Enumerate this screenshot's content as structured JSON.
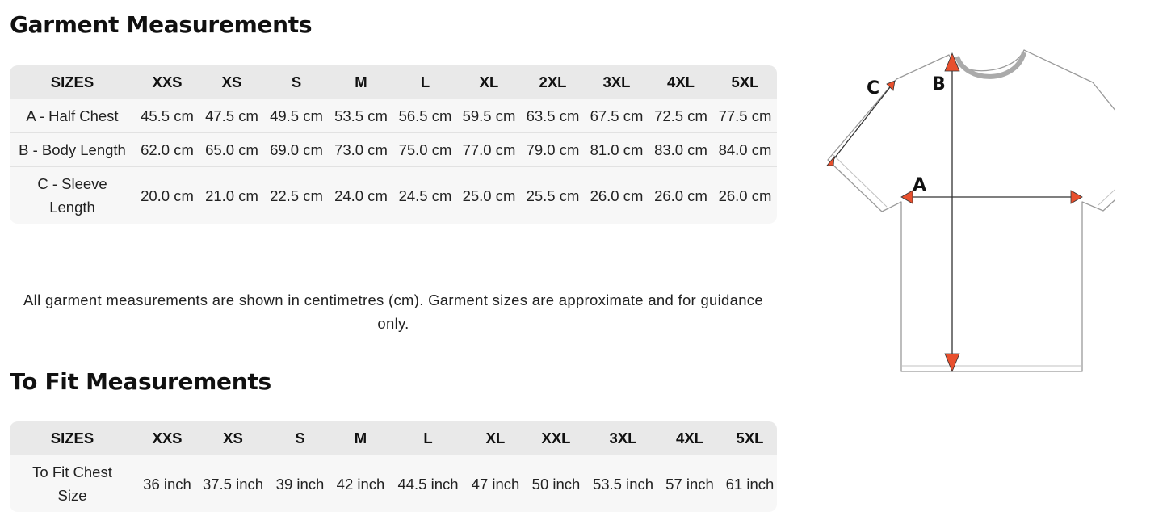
{
  "garment": {
    "title": "Garment Measurements",
    "header": [
      "SIZES",
      "XXS",
      "XS",
      "S",
      "M",
      "L",
      "XL",
      "2XL",
      "3XL",
      "4XL",
      "5XL"
    ],
    "rows": [
      {
        "label": "A - Half Chest",
        "cells": [
          "45.5 cm",
          "47.5 cm",
          "49.5 cm",
          "53.5 cm",
          "56.5 cm",
          "59.5 cm",
          "63.5 cm",
          "67.5 cm",
          "72.5 cm",
          "77.5 cm"
        ]
      },
      {
        "label": "B - Body Length",
        "cells": [
          "62.0 cm",
          "65.0 cm",
          "69.0 cm",
          "73.0 cm",
          "75.0 cm",
          "77.0 cm",
          "79.0 cm",
          "81.0 cm",
          "83.0 cm",
          "84.0 cm"
        ]
      },
      {
        "label": "C - Sleeve Length",
        "cells": [
          "20.0 cm",
          "21.0 cm",
          "22.5 cm",
          "24.0 cm",
          "24.5 cm",
          "25.0 cm",
          "25.5 cm",
          "26.0 cm",
          "26.0 cm",
          "26.0 cm"
        ]
      }
    ],
    "note": "All garment measurements are shown in centimetres (cm). Garment sizes are approximate and for guidance only."
  },
  "fit": {
    "title": "To Fit Measurements",
    "header": [
      "SIZES",
      "XXS",
      "XS",
      "S",
      "M",
      "L",
      "XL",
      "XXL",
      "3XL",
      "4XL",
      "5XL"
    ],
    "rows": [
      {
        "label": "To Fit Chest Size",
        "cells": [
          "36 inch",
          "37.5 inch",
          "39 inch",
          "42 inch",
          "44.5 inch",
          "47 inch",
          "50 inch",
          "53.5 inch",
          "57 inch",
          "61 inch"
        ]
      }
    ]
  },
  "diagram": {
    "labels": {
      "a": "A",
      "b": "B",
      "c": "C"
    },
    "arrow_color": "#e8502e",
    "outline_color": "#9a9a9a"
  }
}
